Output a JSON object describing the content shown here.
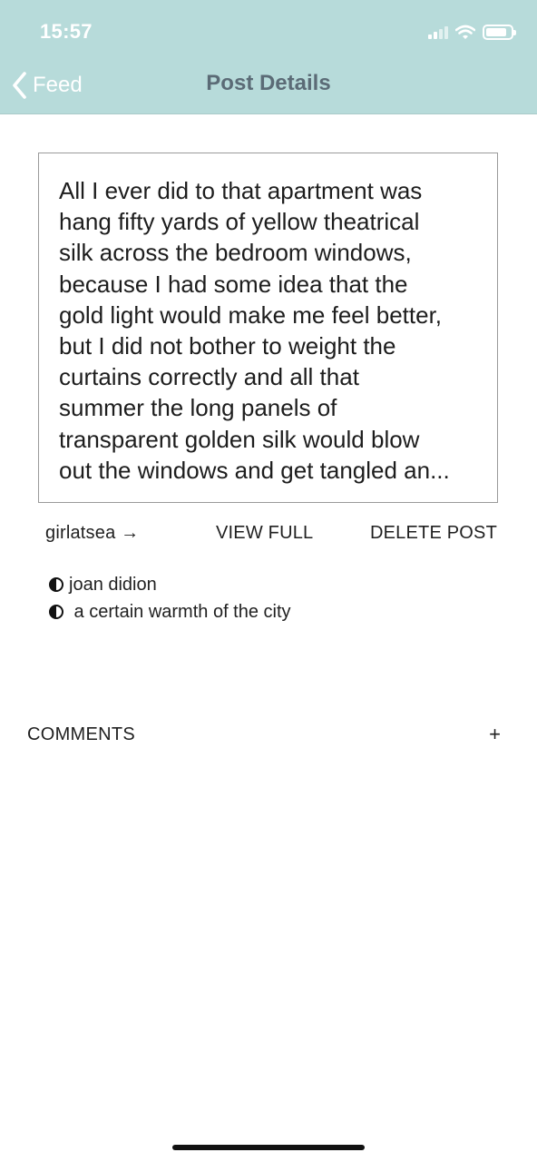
{
  "status_bar": {
    "time": "15:57"
  },
  "nav": {
    "back_label": "Feed",
    "title": "Post Details"
  },
  "post": {
    "text": "All I ever did to that apartment was\nhang fifty yards of yellow theatrical\nsilk across the bedroom windows,\nbecause I had some idea that the\ngold light would make me feel better,\nbut I did not bother to weight the\ncurtains correctly and all that\nsummer the long panels of\ntransparent golden silk would blow\nout the windows and get tangled an..."
  },
  "actions": {
    "author": "girlatsea →",
    "view_full": "VIEW FULL",
    "delete_post": "DELETE POST"
  },
  "tags": [
    {
      "icon": "half-circle-icon",
      "label": "joan didion"
    },
    {
      "icon": "half-circle-icon",
      "label": " a certain warmth of the city"
    }
  ],
  "comments": {
    "label": "COMMENTS",
    "add": "+"
  },
  "colors": {
    "header_bg": "#b7dbda",
    "title": "#5b6b76",
    "card_border": "#9a9a9a"
  }
}
